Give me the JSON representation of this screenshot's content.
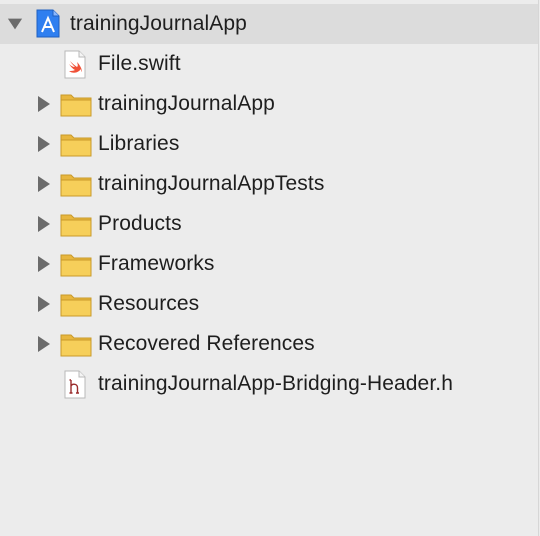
{
  "navigator": {
    "root": {
      "label": "trainingJournalApp",
      "icon": "xcode-project-icon",
      "expanded": true
    },
    "items": [
      {
        "label": "File.swift",
        "icon": "swift-file-icon",
        "type": "file"
      },
      {
        "label": "trainingJournalApp",
        "icon": "folder-icon",
        "type": "group"
      },
      {
        "label": "Libraries",
        "icon": "folder-icon",
        "type": "group"
      },
      {
        "label": "trainingJournalAppTests",
        "icon": "folder-icon",
        "type": "group"
      },
      {
        "label": "Products",
        "icon": "folder-icon",
        "type": "group"
      },
      {
        "label": "Frameworks",
        "icon": "folder-icon",
        "type": "group"
      },
      {
        "label": "Resources",
        "icon": "folder-icon",
        "type": "group"
      },
      {
        "label": "Recovered References",
        "icon": "folder-icon",
        "type": "group"
      },
      {
        "label": "trainingJournalApp-Bridging-Header.h",
        "icon": "header-file-icon",
        "type": "file"
      }
    ]
  },
  "colors": {
    "background": "#ececec",
    "selected_row": "#dcdcdc",
    "folder": "#f2c94c",
    "project_icon": "#2f7ff0",
    "swift": "#f05138",
    "header_h": "#9a2b2b"
  }
}
